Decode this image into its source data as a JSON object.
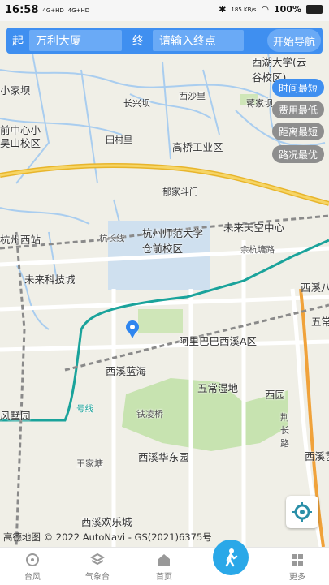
{
  "status": {
    "time": "16:58",
    "signal1": "4G+HD",
    "signal2": "4G+HD",
    "net": "185 KB/s",
    "battery": "100%"
  },
  "route": {
    "start_label": "起",
    "start_value": "万利大厦",
    "end_label": "终",
    "end_placeholder": "请输入终点",
    "go_button": "开始导航"
  },
  "options": [
    {
      "label": "时间最短",
      "active": true
    },
    {
      "label": "费用最低",
      "active": false
    },
    {
      "label": "距离最短",
      "active": false
    },
    {
      "label": "路况最优",
      "active": false
    }
  ],
  "places": [
    "西湖大学(云谷校区)",
    "小家坝",
    "长兴坝",
    "西沙里",
    "蒋家坝",
    "前中心小",
    "吴山校区",
    "田村里",
    "高桥工业区",
    "郁家斗门",
    "杭州西站",
    "杭州师范大学仓前校区",
    "未来天空中心",
    "杭长线",
    "余杭塘路",
    "未来科技城",
    "西溪八",
    "五常",
    "阿里巴巴西溪A区",
    "西溪蓝海",
    "五常湿地",
    "西园",
    "风墅园",
    "号线",
    "铁凌桥",
    "荆长路",
    "西溪华东园",
    "王家塘",
    "西溪欢乐城",
    "西溪艺"
  ],
  "map_copyright": "高德地图 © 2022 AutoNavi - GS(2021)6375号",
  "bottom_nav": [
    "台风",
    "气象台",
    "首页",
    "更多"
  ],
  "colors": {
    "accent": "#3f8ff0",
    "road_yellow": "#f2c43a",
    "metro": "#1aa39b"
  }
}
